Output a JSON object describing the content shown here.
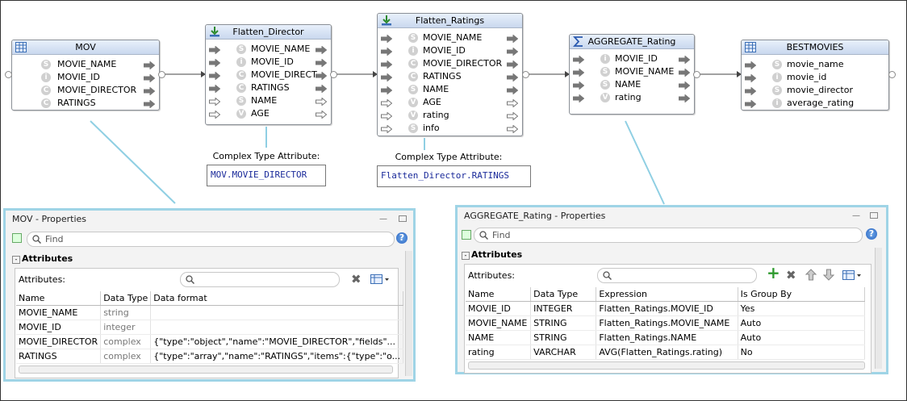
{
  "nodes": {
    "mov": {
      "title": "MOV",
      "attrs": [
        {
          "badge": "S",
          "name": "MOVIE_NAME"
        },
        {
          "badge": "i",
          "name": "MOVIE_ID"
        },
        {
          "badge": "C",
          "name": "MOVIE_DIRECTOR"
        },
        {
          "badge": "C",
          "name": "RATINGS"
        }
      ]
    },
    "flatten_director": {
      "title": "Flatten_Director",
      "attrs": [
        {
          "badge": "S",
          "name": "MOVIE_NAME"
        },
        {
          "badge": "i",
          "name": "MOVIE_ID"
        },
        {
          "badge": "C",
          "name": "MOVIE_DIRECT"
        },
        {
          "badge": "C",
          "name": "RATINGS"
        },
        {
          "badge": "S",
          "name": "NAME"
        },
        {
          "badge": "V",
          "name": "AGE"
        }
      ]
    },
    "flatten_ratings": {
      "title": "Flatten_Ratings",
      "attrs": [
        {
          "badge": "S",
          "name": "MOVIE_NAME"
        },
        {
          "badge": "i",
          "name": "MOVIE_ID"
        },
        {
          "badge": "C",
          "name": "MOVIE_DIRECTOR"
        },
        {
          "badge": "C",
          "name": "RATINGS"
        },
        {
          "badge": "S",
          "name": "NAME"
        },
        {
          "badge": "V",
          "name": "AGE"
        },
        {
          "badge": "V",
          "name": "rating"
        },
        {
          "badge": "S",
          "name": "info"
        }
      ]
    },
    "aggregate_rating": {
      "title": "AGGREGATE_Rating",
      "attrs": [
        {
          "badge": "i",
          "name": "MOVIE_ID"
        },
        {
          "badge": "S",
          "name": "MOVIE_NAME"
        },
        {
          "badge": "S",
          "name": "NAME"
        },
        {
          "badge": "V",
          "name": "rating"
        }
      ]
    },
    "bestmovies": {
      "title": "BESTMOVIES",
      "attrs": [
        {
          "badge": "S",
          "name": "movie_name"
        },
        {
          "badge": "i",
          "name": "movie_id"
        },
        {
          "badge": "S",
          "name": "movie_director"
        },
        {
          "badge": "i",
          "name": "average_rating"
        }
      ]
    }
  },
  "complex_type": {
    "label": "Complex Type Attribute:",
    "director_value": "MOV.MOVIE_DIRECTOR",
    "ratings_value": "Flatten_Director.RATINGS"
  },
  "mov_properties": {
    "title": "MOV - Properties",
    "find_placeholder": "Find",
    "section": "Attributes",
    "attributes_label": "Attributes:",
    "columns": [
      "Name",
      "Data Type",
      "Data format"
    ],
    "rows": [
      [
        "MOVIE_NAME",
        "string",
        ""
      ],
      [
        "MOVIE_ID",
        "integer",
        ""
      ],
      [
        "MOVIE_DIRECTOR",
        "complex",
        "{\"type\":\"object\",\"name\":\"MOVIE_DIRECTOR\",\"fields\"..."
      ],
      [
        "RATINGS",
        "complex",
        "{\"type\":\"array\",\"name\":\"RATINGS\",\"items\":{\"type\":\"o..."
      ]
    ]
  },
  "agg_properties": {
    "title": "AGGREGATE_Rating - Properties",
    "find_placeholder": "Find",
    "section": "Attributes",
    "attributes_label": "Attributes:",
    "columns": [
      "Name",
      "Data Type",
      "Expression",
      "Is Group By"
    ],
    "rows": [
      [
        "MOVIE_ID",
        "INTEGER",
        "Flatten_Ratings.MOVIE_ID",
        "Yes"
      ],
      [
        "MOVIE_NAME",
        "STRING",
        "Flatten_Ratings.MOVIE_NAME",
        "Auto"
      ],
      [
        "NAME",
        "STRING",
        "Flatten_Ratings.NAME",
        "Auto"
      ],
      [
        "rating",
        "VARCHAR",
        "AVG(Flatten_Ratings.rating)",
        "No"
      ]
    ]
  },
  "colors": {
    "panel_border": "#9fd4e6",
    "wire": "#555555",
    "callout": "#8fcfe3"
  }
}
